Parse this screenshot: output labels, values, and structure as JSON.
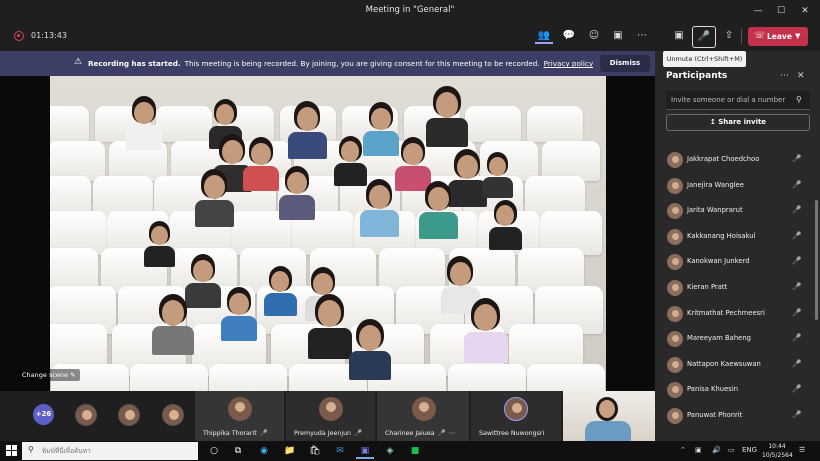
{
  "window": {
    "title": "Meeting in \"General\"",
    "minimize": "—",
    "maximize": "☐",
    "close": "✕"
  },
  "toolbar": {
    "timer": "01:13:43",
    "leave_label": "Leave",
    "mic_tooltip": "Unmute (Ctrl+Shift+M)"
  },
  "banner": {
    "heading": "Recording has started.",
    "message": "This meeting is being recorded. By joining, you are giving consent for this meeting to be recorded.",
    "link": "Privacy policy",
    "dismiss_label": "Dismiss"
  },
  "stage": {
    "change_scene_label": "Change scene ✎"
  },
  "participants_panel": {
    "title": "Participants",
    "invite_placeholder": "Invite someone or dial a number",
    "share_invite_label": "Share invite",
    "participants": [
      {
        "name": "Jakkrapat Choedchoo"
      },
      {
        "name": "Janejira Wanglee"
      },
      {
        "name": "Jarita Wanprarut"
      },
      {
        "name": "Kakkanang Hoisakul"
      },
      {
        "name": "Kanokwan Junkerd"
      },
      {
        "name": "Kieran Pratt"
      },
      {
        "name": "Kritmathat Pechmeesri"
      },
      {
        "name": "Mareeyam Baheng"
      },
      {
        "name": "Nattapon Kaewsuwan"
      },
      {
        "name": "Panisa Khuesin"
      },
      {
        "name": "Panuwat Phonrit"
      }
    ]
  },
  "gallery": {
    "more_count": "+26",
    "tiles": [
      {
        "name": "Thippika Thorarit"
      },
      {
        "name": "Premyuda Jeenjun"
      },
      {
        "name": "Charinee Jaiuea"
      },
      {
        "name": "Sawittree Nuwongsri"
      }
    ]
  },
  "taskbar": {
    "search_placeholder": "พิมพ์ที่นี่เพื่อค้นหา",
    "language": "ENG",
    "time": "10:44",
    "date": "10/5/2564"
  },
  "colors": {
    "accent": "#5b5fc7",
    "leave": "#c4314b",
    "banner": "#3d3e66",
    "panel": "#292929"
  }
}
